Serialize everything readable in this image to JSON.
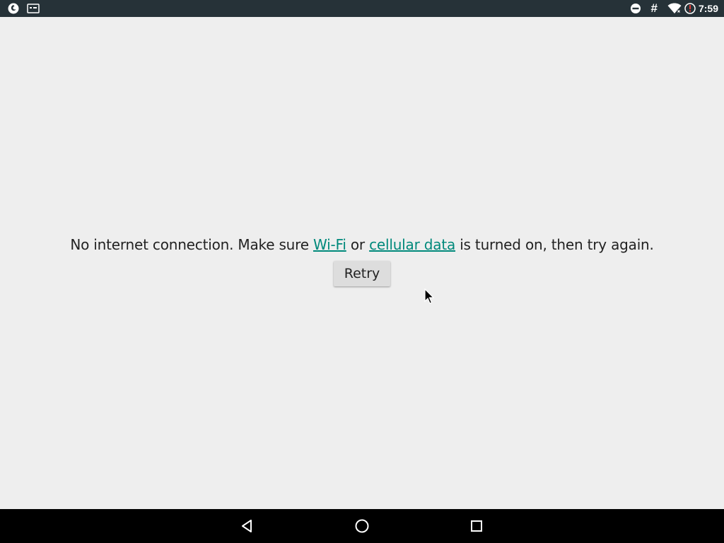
{
  "status_bar": {
    "left_icons": [
      "firefox-icon",
      "screen-icon"
    ],
    "right_icons": [
      "dnd-icon",
      "hash-icon",
      "wifi-icon",
      "alert-icon"
    ],
    "hash_symbol": "#",
    "time": "7:59",
    "background": "#263238"
  },
  "main": {
    "message": {
      "before_wifi": "No internet connection. Make sure ",
      "wifi_link": "Wi-Fi",
      "between": " or ",
      "cellular_link": "cellular data",
      "after": " is turned on, then try again."
    },
    "retry_label": "Retry",
    "link_color": "#00897b",
    "background": "#eeeeee"
  },
  "nav_bar": {
    "buttons": [
      "back-icon",
      "home-icon",
      "recents-icon"
    ]
  }
}
